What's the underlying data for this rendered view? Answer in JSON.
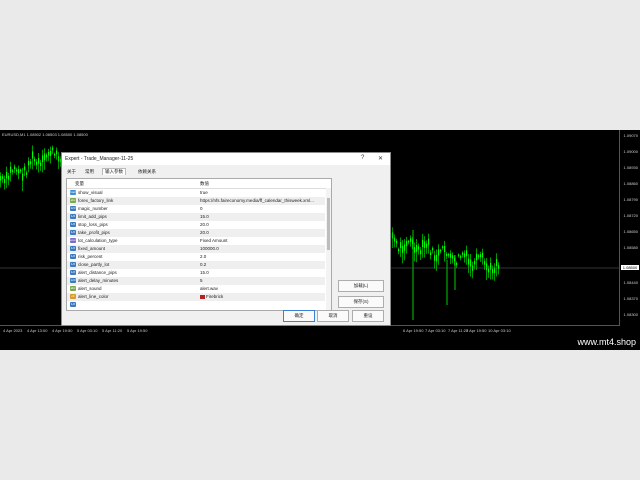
{
  "chart": {
    "header": "EURUSD,M1  1.08502 1.08503 1.08500 1.08500",
    "price_ticks": [
      "1.09070",
      "1.09000",
      "1.08930",
      "1.08860",
      "1.08790",
      "1.08720",
      "1.08650",
      "1.08580",
      "1.08510",
      "1.08440",
      "1.08370",
      "1.08300"
    ],
    "current_price": "1.08500",
    "time_ticks": [
      "4 Apr 2023",
      "4 Apr 13:00",
      "4 Apr 19:50",
      "5 Apr 03:10",
      "5 Apr 11:20",
      "5 Apr 19:50",
      "6 Apr 03:10",
      "6 Apr 11:20",
      "6 Apr 19:50",
      "7 Apr 03:10",
      "7 Apr 11:20",
      "7 Apr 19:50",
      "10 Apr 03:10"
    ],
    "colors": {
      "background": "#000000",
      "candles": "#00ff00"
    }
  },
  "watermark": "www.mt4.shop",
  "dialog": {
    "title": "Expert - Trade_Manager-11-25",
    "help_icon": "?",
    "close_icon": "✕",
    "tabs": [
      "关于",
      "常用",
      "输入参数",
      "依赖关系"
    ],
    "active_tab": 2,
    "columns": {
      "variable": "变量",
      "value": "数值"
    },
    "rows": [
      {
        "type": "bool",
        "name": "show_visual",
        "value": "true"
      },
      {
        "type": "string",
        "name": "forex_factory_link",
        "value": "https://nfs.faireconomy.media/ff_calendar_thisweek.xml..."
      },
      {
        "type": "int",
        "name": "magic_number",
        "value": "0"
      },
      {
        "type": "double",
        "name": "limit_add_pips",
        "value": "15.0"
      },
      {
        "type": "double",
        "name": "stop_loss_pips",
        "value": "20.0"
      },
      {
        "type": "double",
        "name": "take_profit_pips",
        "value": "20.0"
      },
      {
        "type": "enum",
        "name": "lot_calculation_type",
        "value": "Fixed Amount"
      },
      {
        "type": "double",
        "name": "fixed_amount",
        "value": "100000.0"
      },
      {
        "type": "double",
        "name": "risk_percent",
        "value": "2.0"
      },
      {
        "type": "double",
        "name": "close_partly_lot",
        "value": "0.2"
      },
      {
        "type": "double",
        "name": "alert_distance_pips",
        "value": "15.0"
      },
      {
        "type": "int",
        "name": "alert_delay_minutes",
        "value": "5"
      },
      {
        "type": "string",
        "name": "alert_sound",
        "value": "alert.wav"
      },
      {
        "type": "color",
        "name": "alert_line_color",
        "value": "Firebrick",
        "swatch": "#b22222"
      },
      {
        "type": "double",
        "name": "",
        "value": ""
      }
    ],
    "type_colors": {
      "bool": "#3f8fd2",
      "string": "#7aa84a",
      "int": "#3a7ac0",
      "double": "#3a7ac0",
      "enum": "#7d6bc9",
      "color": "#d79a2c"
    },
    "side_buttons": {
      "load": "加载(L)",
      "save": "保存(S)"
    },
    "footer_buttons": {
      "ok": "确定",
      "cancel": "取消",
      "reset": "重设"
    }
  }
}
